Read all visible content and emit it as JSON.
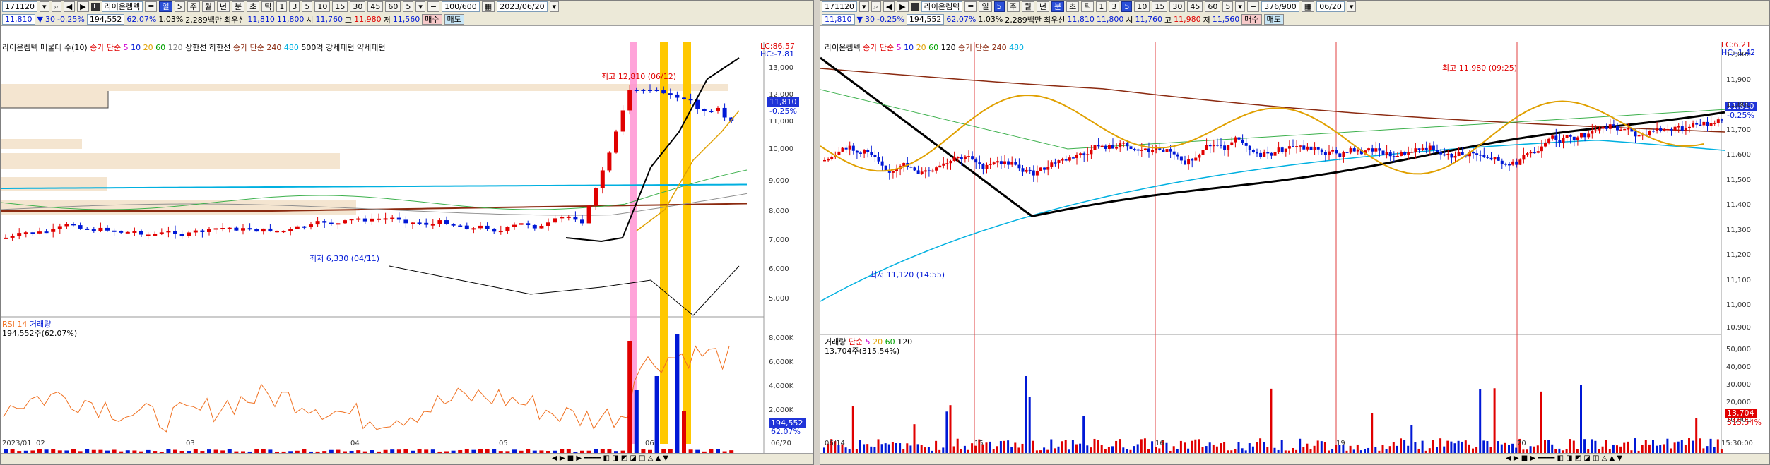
{
  "left": {
    "toolbar": {
      "code": "171120",
      "company": "라이온켐텍",
      "period_d": "일",
      "period_n": "5",
      "periods": [
        "주",
        "월",
        "년",
        "분",
        "초",
        "틱"
      ],
      "nums": [
        "1",
        "3",
        "5",
        "10",
        "15",
        "30",
        "45",
        "60",
        "5"
      ],
      "count": "100/600",
      "date": "2023/06/20"
    },
    "quote": {
      "price": "11,810",
      "change": "30",
      "pct": "-0.25%",
      "volume": "194,552",
      "ratio": "62.07%",
      "x": "1.03%",
      "amount": "2,289백만",
      "best": "최우선",
      "ask": "11,810",
      "bid": "11,800",
      "open_lbl": "시",
      "open": "11,760",
      "high_lbl": "고",
      "high": "11,980",
      "low_lbl": "저",
      "low": "11,560",
      "buy": "매수",
      "sell": "매도"
    },
    "legend": {
      "name": "라이온켐텍",
      "items": [
        "매물대 수(10)",
        "종가 단순",
        "5",
        "10",
        "20",
        "60",
        "120",
        "상한선",
        "하한선",
        "종가 단순 240",
        "480",
        "500억 강세패턴",
        "약세패턴"
      ]
    },
    "lc": "LC:86.57",
    "hc": "HC:-7.81",
    "high_note": "최고 12,810 (06/12)",
    "low_note": "최저 6,330 (04/11)",
    "price_tag": "11,810",
    "price_pct": "-0.25%",
    "y_labels": [
      "13,000",
      "12,000",
      "11,000",
      "10,000",
      "9,000",
      "8,000",
      "7,000",
      "6,000",
      "5,000"
    ],
    "lower_legend": [
      "RSI 14",
      "거래량"
    ],
    "lower_sub": "194,552주(62.07%)",
    "vol_labels": [
      "8,000K",
      "6,000K",
      "4,000K",
      "2,000K"
    ],
    "vol_tag": "194,552",
    "vol_pct": "62.07%",
    "x_labels": [
      "2023/01",
      "02",
      "03",
      "04",
      "05",
      "06",
      "06/20"
    ],
    "chart_data": {
      "type": "candlestick",
      "ylim": [
        4500,
        13500
      ],
      "annotations": [
        "최고 12,810 (06/12)",
        "최저 6,330 (04/11)"
      ],
      "series": [
        {
          "name": "종가 단순 5"
        },
        {
          "name": "10"
        },
        {
          "name": "20"
        },
        {
          "name": "60"
        },
        {
          "name": "120"
        },
        {
          "name": "240"
        },
        {
          "name": "480"
        }
      ]
    }
  },
  "right": {
    "toolbar": {
      "code": "171120",
      "company": "라이온켐텍",
      "period_d": "일",
      "period_n": "5",
      "periods": [
        "주",
        "월",
        "년",
        "분",
        "초",
        "틱"
      ],
      "nums": [
        "1",
        "3",
        "5",
        "10",
        "15",
        "30",
        "45",
        "60",
        "5"
      ],
      "count": "376/900",
      "date": "06/20"
    },
    "quote": {
      "price": "11,810",
      "change": "30",
      "pct": "-0.25%",
      "volume": "194,552",
      "ratio": "62.07%",
      "x": "1.03%",
      "amount": "2,289백만",
      "best": "최우선",
      "ask": "11,810",
      "bid": "11,800",
      "open_lbl": "시",
      "open": "11,760",
      "high_lbl": "고",
      "high": "11,980",
      "low_lbl": "저",
      "low": "11,560",
      "buy": "매수",
      "sell": "매도"
    },
    "legend": {
      "name": "라이온켐텍",
      "items": [
        "종가 단순",
        "5",
        "10",
        "20",
        "60",
        "120",
        "종가 단순 240",
        "480"
      ]
    },
    "lc": "LC:6.21",
    "hc": "HC:-1.42",
    "high_note": "최고 11,980 (09:25)",
    "low_note": "최저 11,120 (14:55)",
    "price_tag": "11,810",
    "price_pct": "-0.25%",
    "y_labels": [
      "12,000",
      "11,900",
      "11,800",
      "11,700",
      "11,600",
      "11,500",
      "11,400",
      "11,300",
      "11,200",
      "11,100",
      "11,000",
      "10,900"
    ],
    "lower_legend": [
      "거래량",
      "단순",
      "5",
      "20",
      "60",
      "120"
    ],
    "lower_sub": "13,704주(315.54%)",
    "vol_labels": [
      "50,000",
      "40,000",
      "30,000",
      "20,000",
      "10,000"
    ],
    "vol_tag": "13,704",
    "vol_pct": "315.54%",
    "x_labels": [
      "06/14",
      "15",
      "16",
      "19",
      "20",
      "15:30:00"
    ],
    "chart_data": {
      "type": "candlestick",
      "ylim": [
        10900,
        12050
      ],
      "annotations": [
        "최고 11,980 (09:25)",
        "최저 11,120 (14:55)"
      ],
      "series": [
        {
          "name": "종가 단순 5"
        },
        {
          "name": "10"
        },
        {
          "name": "20"
        },
        {
          "name": "60"
        },
        {
          "name": "120"
        },
        {
          "name": "240"
        },
        {
          "name": "480"
        }
      ]
    }
  }
}
